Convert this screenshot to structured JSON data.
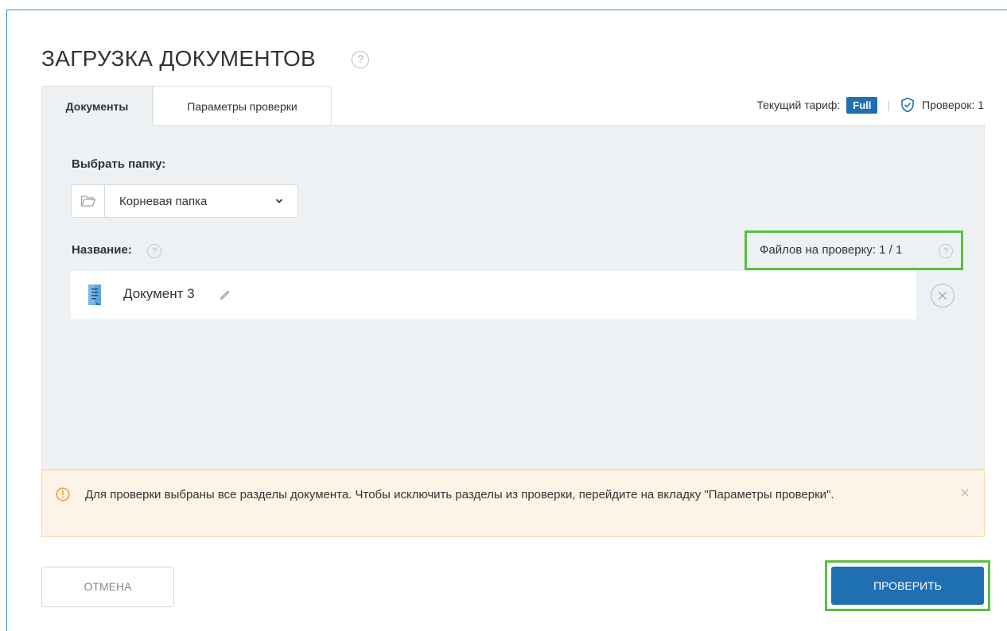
{
  "page": {
    "title": "ЗАГРУЗКА ДОКУМЕНТОВ",
    "title_help": "?"
  },
  "tabs": [
    {
      "label": "Документы",
      "active": true
    },
    {
      "label": "Параметры проверки",
      "active": false
    }
  ],
  "tariff": {
    "label": "Текущий тариф:",
    "plan": "Full",
    "checks_label": "Проверок: 1"
  },
  "folder": {
    "label": "Выбрать папку:",
    "selected": "Корневая папка"
  },
  "documents": {
    "name_label": "Название:",
    "files_count": "Файлов на проверку: 1 / 1",
    "help": "?",
    "items": [
      {
        "name": "Документ 3"
      }
    ]
  },
  "alert": {
    "text": "Для проверки выбраны все разделы документа. Чтобы исключить разделы из проверки, перейдите на вкладку \"Параметры проверки\"."
  },
  "actions": {
    "cancel_label": "ОТМЕНА",
    "check_label": "ПРОВЕРИТЬ"
  },
  "colors": {
    "primary": "#1f6fb3",
    "highlight": "#5ac043",
    "panel_bg": "#eef1f3",
    "alert_bg": "#fdf3e7"
  }
}
